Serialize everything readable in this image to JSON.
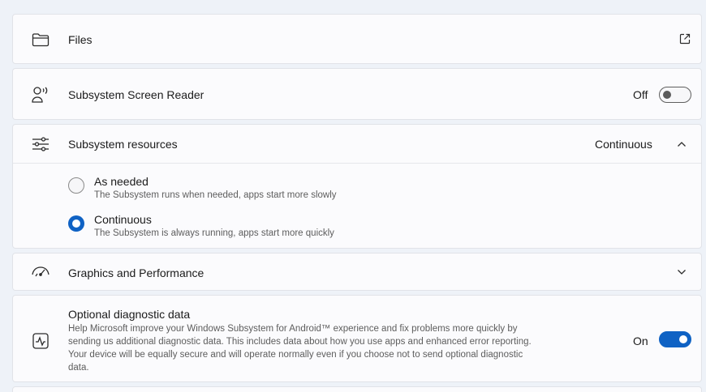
{
  "files": {
    "label": "Files",
    "icon": "folder-icon",
    "action_icon": "open-external-icon"
  },
  "screen_reader": {
    "label": "Subsystem Screen Reader",
    "icon": "screen-reader-icon",
    "state_text": "Off",
    "enabled": false
  },
  "resources": {
    "label": "Subsystem resources",
    "icon": "sliders-icon",
    "current_value": "Continuous",
    "expanded": true,
    "options": [
      {
        "title": "As needed",
        "description": "The Subsystem runs when needed, apps start more slowly",
        "selected": false
      },
      {
        "title": "Continuous",
        "description": "The Subsystem is always running, apps start more quickly",
        "selected": true
      }
    ]
  },
  "graphics": {
    "label": "Graphics and Performance",
    "icon": "speedometer-icon",
    "expanded": false
  },
  "diagnostics": {
    "title": "Optional diagnostic data",
    "icon": "pulse-monitor-icon",
    "description_lines": [
      "Help Microsoft improve your Windows Subsystem for Android™ experience and fix problems more quickly by",
      "sending us additional diagnostic data. This includes data about how you use apps and enhanced error reporting.",
      "Your device will be equally secure and will operate normally even if you choose not to send optional diagnostic",
      "data."
    ],
    "state_text": "On",
    "enabled": true
  },
  "colors": {
    "accent": "#0f62c4",
    "background": "#eef2f8",
    "card": "#fbfbfd"
  }
}
